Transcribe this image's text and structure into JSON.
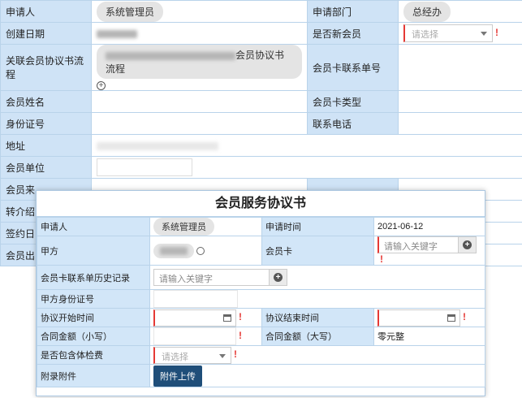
{
  "main_form": {
    "applicant_label": "申请人",
    "applicant_value": "系统管理员",
    "dept_label": "申请部门",
    "dept_value": "总经办",
    "created_label": "创建日期",
    "new_member_label": "是否新会员",
    "new_member_placeholder": "请选择",
    "flow_label": "关联会员协议书流程",
    "flow_value_suffix": "会员协议书流程",
    "card_contact_label": "会员卡联系单号",
    "member_name_label": "会员姓名",
    "card_type_label": "会员卡类型",
    "id_label": "身份证号",
    "phone_label": "联系电话",
    "address_label": "地址",
    "unit_label": "会员单位",
    "source_label_partial": "会员来",
    "referrer_label_partial": "转介绍",
    "sign_label_partial": "签约日",
    "birth_label_partial": "会员出"
  },
  "dialog": {
    "title": "会员服务协议书",
    "applicant_label": "申请人",
    "applicant_value": "系统管理员",
    "apply_time_label": "申请时间",
    "apply_time_value": "2021-06-12",
    "party_a_label": "甲方",
    "member_card_label": "会员卡",
    "member_card_placeholder": "请输入关键字",
    "history_label": "会员卡联系单历史记录",
    "history_placeholder": "请输入关键字",
    "party_a_id_label": "甲方身份证号",
    "start_label": "协议开始时间",
    "end_label": "协议结束时间",
    "amount_small_label": "合同金额（小写）",
    "amount_big_label": "合同金额（大写）",
    "amount_big_value": "零元整",
    "checkup_label": "是否包含体检费",
    "checkup_placeholder": "请选择",
    "attachment_label": "附录附件",
    "upload_label": "附件上传"
  },
  "required_mark": "!",
  "colors": {
    "label_bg": "#cfe3f6",
    "border": "#b9d3ea",
    "required": "#e53935",
    "upload_button": "#1f4e79"
  }
}
